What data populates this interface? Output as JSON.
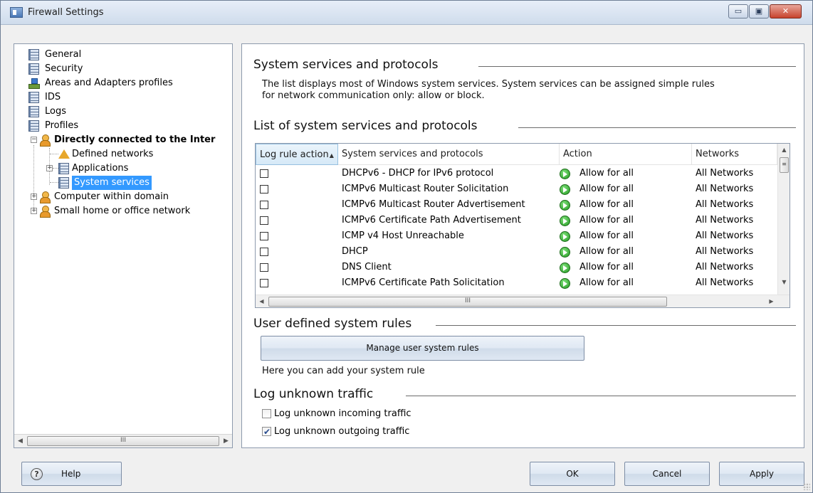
{
  "window": {
    "title": "Firewall Settings",
    "controls": {
      "minimize": "▭",
      "maximize": "▣",
      "close": "✕"
    }
  },
  "tree": {
    "items": [
      {
        "label": "General",
        "icon": "document-icon"
      },
      {
        "label": "Security",
        "icon": "document-icon"
      },
      {
        "label": "Areas and Adapters profiles",
        "icon": "network-icon"
      },
      {
        "label": "IDS",
        "icon": "document-icon"
      },
      {
        "label": "Logs",
        "icon": "document-icon"
      },
      {
        "label": "Profiles",
        "icon": "document-icon"
      },
      {
        "label": "Directly connected to the Inter",
        "icon": "user-profile-icon",
        "expander": "−"
      },
      {
        "label": "Defined networks",
        "icon": "warning-network-icon"
      },
      {
        "label": "Applications",
        "icon": "document-icon",
        "expander": "+"
      },
      {
        "label": "System services",
        "icon": "document-icon"
      },
      {
        "label": "Computer within domain",
        "icon": "user-profile-icon",
        "expander": "+"
      },
      {
        "label": "Small home or office network",
        "icon": "user-profile-icon",
        "expander": "+"
      }
    ],
    "scroll_left": "◀",
    "scroll_right": "▶",
    "scroll_grip": "III"
  },
  "main": {
    "section1_title": "System services and protocols",
    "description": "The list displays most of Windows system services. System services can be assigned simple rules for network communication only: allow or block.",
    "section2_title": "List of system services and protocols",
    "table": {
      "columns": [
        "Log rule action",
        "System services and protocols",
        "Action",
        "Networks"
      ],
      "sort_indicator": "▲",
      "rows": [
        {
          "service": "DHCPv6 - DHCP for IPv6 protocol",
          "action": "Allow for all",
          "networks": "All Networks"
        },
        {
          "service": "ICMPv6 Multicast Router Solicitation",
          "action": "Allow for all",
          "networks": "All Networks"
        },
        {
          "service": "ICMPv6 Multicast Router Advertisement",
          "action": "Allow for all",
          "networks": "All Networks"
        },
        {
          "service": "ICMPv6 Certificate Path Advertisement",
          "action": "Allow for all",
          "networks": "All Networks"
        },
        {
          "service": "ICMP v4 Host Unreachable",
          "action": "Allow for all",
          "networks": "All Networks"
        },
        {
          "service": "DHCP",
          "action": "Allow for all",
          "networks": "All Networks"
        },
        {
          "service": "DNS Client",
          "action": "Allow for all",
          "networks": "All Networks"
        },
        {
          "service": "ICMPv6 Certificate Path Solicitation",
          "action": "Allow for all",
          "networks": "All Networks"
        }
      ],
      "scroll_up": "▲",
      "scroll_down": "▼",
      "scroll_left": "◀",
      "scroll_right": "▶",
      "scroll_grip_v": "≡",
      "scroll_grip_h": "III"
    },
    "section3_title": "User defined system rules",
    "manage_button": "Manage user system rules",
    "hint": "Here you can add your system rule",
    "section4_title": "Log unknown traffic",
    "log_incoming": {
      "label": "Log unknown incoming traffic",
      "checked": false
    },
    "log_outgoing": {
      "label": "Log unknown outgoing traffic",
      "checked": true
    }
  },
  "footer": {
    "help": "Help",
    "help_icon": "?",
    "ok": "OK",
    "cancel": "Cancel",
    "apply": "Apply"
  }
}
